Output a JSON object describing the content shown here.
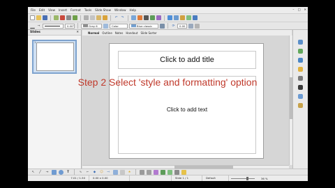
{
  "menu": [
    "File",
    "Edit",
    "View",
    "Insert",
    "Format",
    "Tools",
    "Slide Show",
    "Window",
    "Help"
  ],
  "window_controls": {
    "minimize": "–",
    "maximize": "□",
    "close": "✕"
  },
  "toolbar2": {
    "line_width": "0.00\"",
    "line_color": "Gray 6",
    "area_fill": "Color",
    "area_color": "Blue classic",
    "angle": "0.00"
  },
  "slides_pane": {
    "title": "Slides",
    "close": "✕",
    "thumb_number": "1"
  },
  "view_tabs": [
    "Normal",
    "Outline",
    "Notes",
    "Handout",
    "Slide Sorter"
  ],
  "slide": {
    "title_placeholder": "Click to add title",
    "text_placeholder": "Click to add text"
  },
  "caption": "Step 2 Select 'style and formatting' option",
  "statusbar": {
    "position": "7.01 / 1.50",
    "size": "0.00 x 0.00",
    "slide": "Slide 1 / 1",
    "layout": "Default",
    "zoom": "36 %"
  },
  "colors": {
    "caption": "#c0392b",
    "thumb_border": "#7da2ce"
  },
  "sidebar_icons": [
    "properties-icon",
    "styles-icon",
    "gallery-icon",
    "navigator-icon",
    "animation-icon",
    "transition-icon",
    "master-slides-icon",
    "functions-icon"
  ]
}
